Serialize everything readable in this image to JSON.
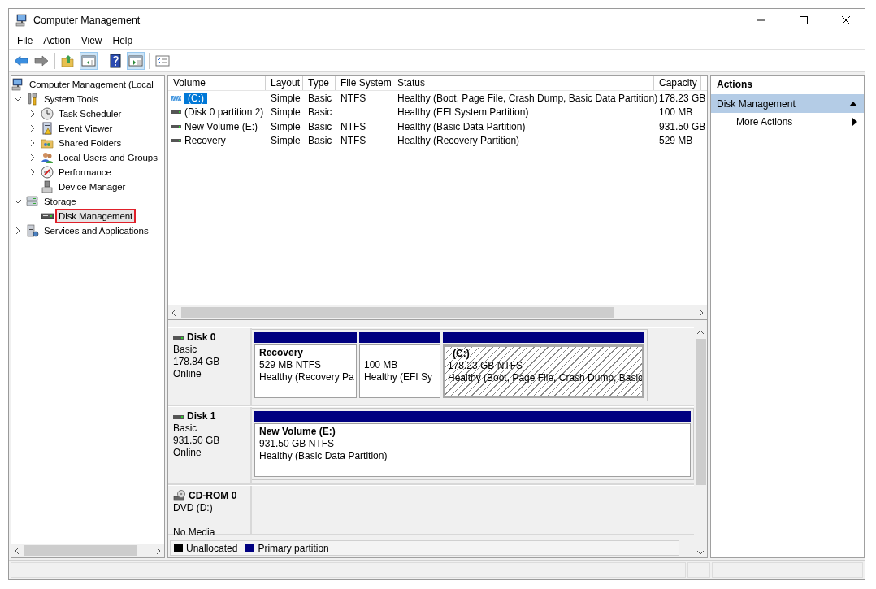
{
  "window": {
    "title": "Computer Management"
  },
  "menu": [
    "File",
    "Action",
    "View",
    "Help"
  ],
  "toolbar": [
    {
      "kind": "back",
      "pressed": false
    },
    {
      "kind": "forward",
      "pressed": false
    },
    {
      "kind": "separator"
    },
    {
      "kind": "up",
      "pressed": false
    },
    {
      "kind": "console-tree",
      "pressed": true
    },
    {
      "kind": "separator"
    },
    {
      "kind": "help",
      "pressed": false
    },
    {
      "kind": "action-pane",
      "pressed": true
    },
    {
      "kind": "separator"
    },
    {
      "kind": "properties",
      "pressed": false
    }
  ],
  "tree": [
    {
      "label": "Computer Management (Local",
      "kind": "root",
      "selected": false,
      "children": [
        {
          "label": "System Tools",
          "kind": "branch",
          "expanded": true,
          "selected": false,
          "children": [
            {
              "label": "Task Scheduler",
              "kind": "branch",
              "expanded": false,
              "selected": false
            },
            {
              "label": "Event Viewer",
              "kind": "branch",
              "expanded": false,
              "selected": false
            },
            {
              "label": "Shared Folders",
              "kind": "branch",
              "expanded": false,
              "selected": false
            },
            {
              "label": "Local Users and Groups",
              "kind": "branch",
              "expanded": false,
              "selected": false
            },
            {
              "label": "Performance",
              "kind": "branch",
              "expanded": false,
              "selected": false
            },
            {
              "label": "Device Manager",
              "kind": "leaf",
              "selected": false
            }
          ]
        },
        {
          "label": "Storage",
          "kind": "branch",
          "expanded": true,
          "selected": false,
          "children": [
            {
              "label": "Disk Management",
              "kind": "leaf",
              "selected": true
            }
          ]
        },
        {
          "label": "Services and Applications",
          "kind": "branch",
          "expanded": false,
          "selected": false
        }
      ]
    }
  ],
  "volumes": {
    "columns": [
      "Volume",
      "Layout",
      "Type",
      "File System",
      "Status",
      "Capacity"
    ],
    "rows": [
      {
        "volume": "(C:)",
        "layout": "Simple",
        "type": "Basic",
        "file_system": "NTFS",
        "status": "Healthy (Boot, Page File, Crash Dump, Basic Data Partition)",
        "capacity": "178.23 GB",
        "selected": true
      },
      {
        "volume": "(Disk 0 partition 2)",
        "layout": "Simple",
        "type": "Basic",
        "status": "Healthy (EFI System Partition)",
        "capacity": "100 MB",
        "selected": false
      },
      {
        "volume": "New Volume (E:)",
        "layout": "Simple",
        "type": "Basic",
        "file_system": "NTFS",
        "status": "Healthy (Basic Data Partition)",
        "capacity": "931.50 GB",
        "selected": false
      },
      {
        "volume": "Recovery",
        "layout": "Simple",
        "type": "Basic",
        "file_system": "NTFS",
        "status": "Healthy (Recovery Partition)",
        "capacity": "529 MB",
        "selected": false
      }
    ]
  },
  "disks": [
    {
      "name": "Disk 0",
      "kind": "disk",
      "type": "Basic",
      "size": "178.84 GB",
      "status": "Online",
      "partitions": [
        {
          "name": "Recovery",
          "size_fs": "529 MB NTFS",
          "status": "Healthy (Recovery Pa",
          "selected": false
        },
        {
          "size_fs": "100 MB",
          "status": "Healthy (EFI Sy",
          "selected": false
        },
        {
          "name": "(C:)",
          "size_fs": "178.23 GB NTFS",
          "status": "Healthy (Boot, Page File, Crash Dump, Basic",
          "selected": true
        }
      ]
    },
    {
      "name": "Disk 1",
      "kind": "disk",
      "type": "Basic",
      "size": "931.50 GB",
      "status": "Online",
      "partitions": [
        {
          "name": "New Volume  (E:)",
          "size_fs": "931.50 GB NTFS",
          "status": "Healthy (Basic Data Partition)",
          "selected": false
        }
      ]
    },
    {
      "name": "CD-ROM 0",
      "kind": "cdrom",
      "type": "DVD (D:)",
      "status": "No Media"
    }
  ],
  "legend": [
    {
      "label": "Unallocated",
      "color": "#000000"
    },
    {
      "label": "Primary partition",
      "color": "#000080"
    }
  ],
  "actions": {
    "title": "Actions",
    "sections": [
      {
        "label": "Disk Management",
        "expanded": true,
        "items": [
          {
            "label": "More Actions"
          }
        ]
      }
    ]
  }
}
